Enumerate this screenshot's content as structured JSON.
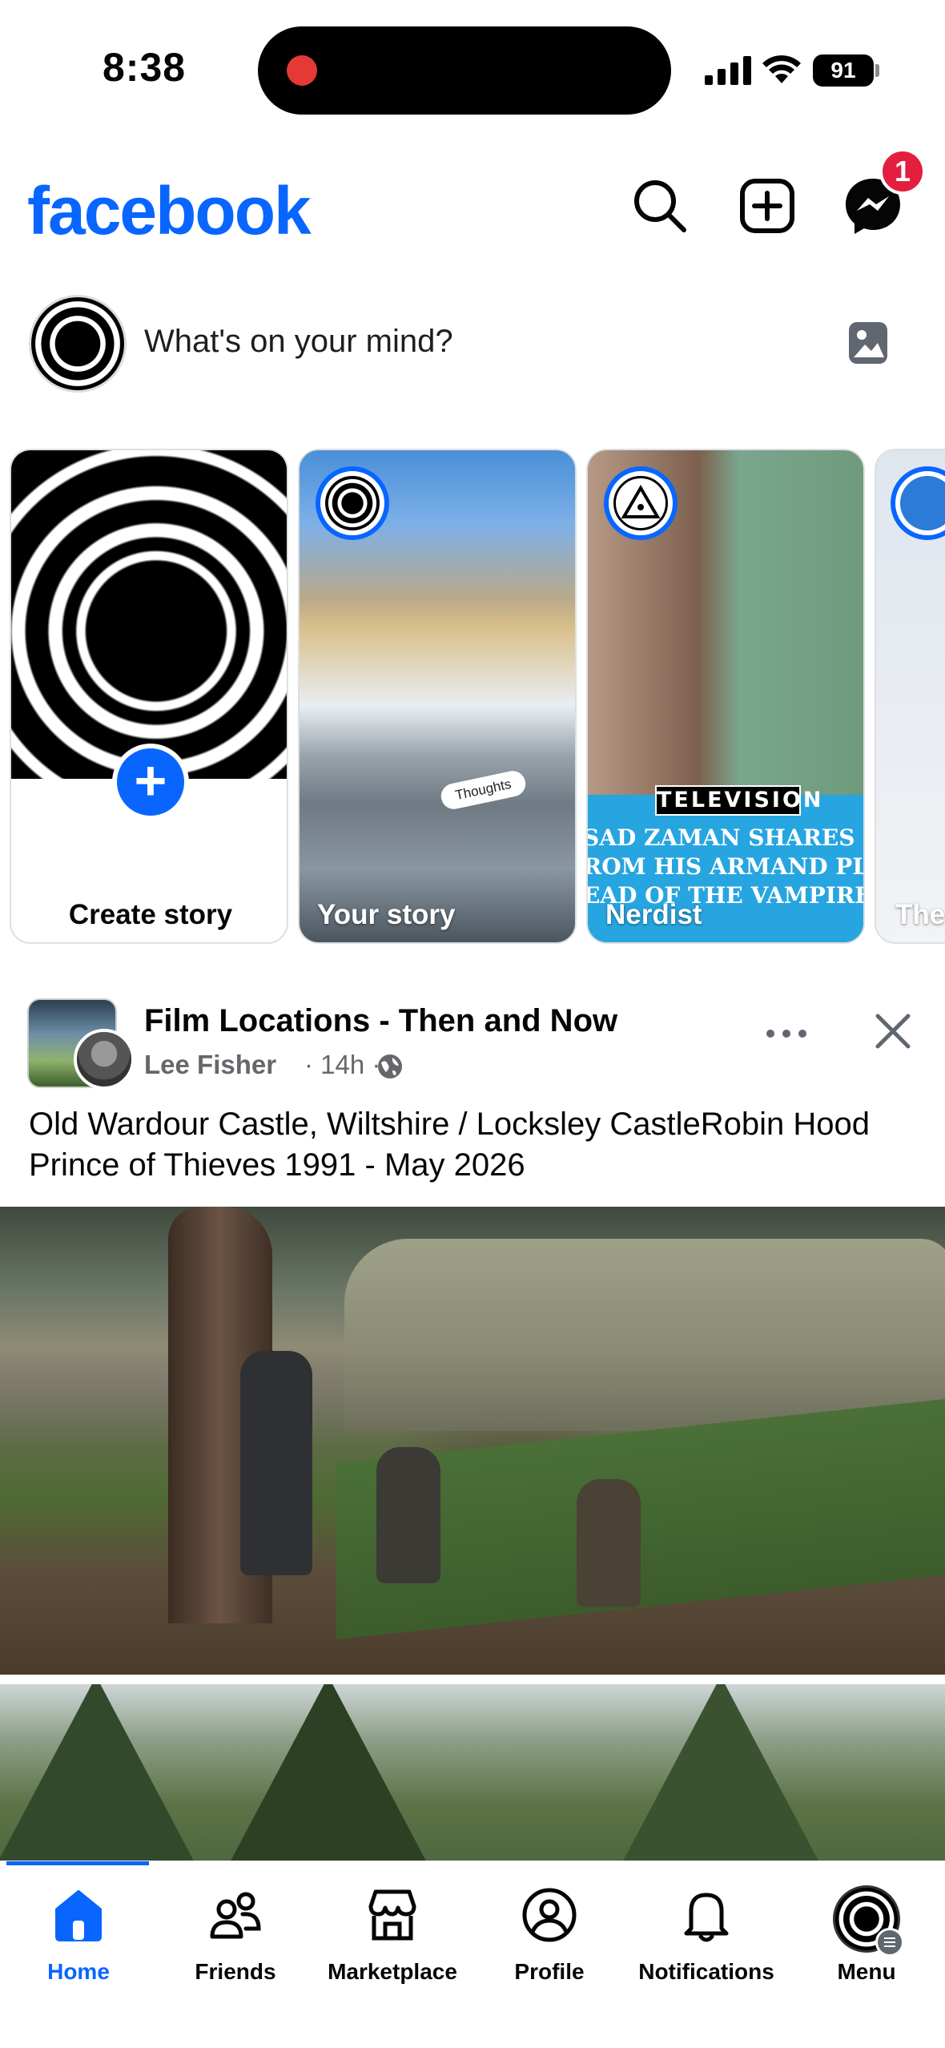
{
  "status_bar": {
    "time": "8:38",
    "battery": "91"
  },
  "header": {
    "logo": "facebook",
    "messenger_badge": "1"
  },
  "composer": {
    "placeholder": "What's on your mind?"
  },
  "stories": {
    "create_label": "Create story",
    "items": [
      {
        "name": "Your story",
        "sticker": "Thoughts"
      },
      {
        "name": "Nerdist",
        "tag": "TELEVISION",
        "headline": [
          "SAD ZAMAN SHARES SON",
          "ROM HIS ARMAND PLAYLIS",
          "EAD OF THE VAMPIRE LES"
        ]
      },
      {
        "name": "The"
      }
    ]
  },
  "post": {
    "title": "Film Locations - Then and Now",
    "author": "Lee Fisher",
    "time": "· 14h ·",
    "text": "Old Wardour Castle, Wiltshire / Locksley CastleRobin Hood Prince of Thieves 1991 - May 2026"
  },
  "bottom_nav": {
    "items": [
      {
        "label": "Home",
        "icon": "home-icon",
        "active": true
      },
      {
        "label": "Friends",
        "icon": "friends-icon"
      },
      {
        "label": "Marketplace",
        "icon": "marketplace-icon"
      },
      {
        "label": "Profile",
        "icon": "profile-icon"
      },
      {
        "label": "Notifications",
        "icon": "bell-icon"
      },
      {
        "label": "Menu",
        "icon": "menu-avatar"
      }
    ]
  },
  "colors": {
    "brand": "#0866ff",
    "badge": "#e41e3f",
    "secondary_text": "#65676b"
  }
}
